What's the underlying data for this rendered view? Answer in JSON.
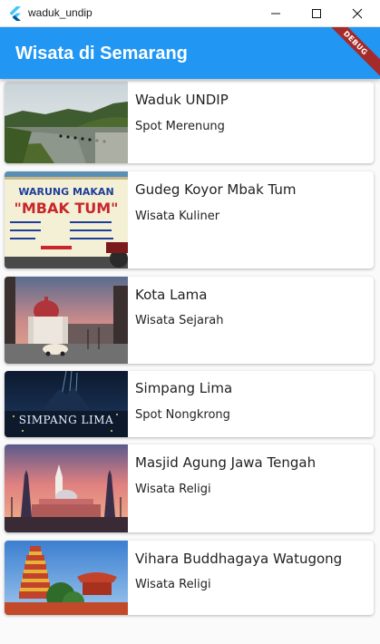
{
  "window": {
    "title": "waduk_undip",
    "controls": [
      "minimize-icon",
      "maximize-icon",
      "close-icon"
    ]
  },
  "appbar": {
    "title": "Wisata di Semarang",
    "debug_banner": "DEBUG",
    "color": "#2196f3"
  },
  "places": [
    {
      "name": "Waduk UNDIP",
      "category": "Spot Merenung",
      "image": "reservoir-photo"
    },
    {
      "name": "Gudeg Koyor Mbak Tum",
      "category": "Wisata Kuliner",
      "image": "warung-makan-sign-photo",
      "image_text": {
        "line1": "WARUNG MAKAN",
        "line2": "\"MBAK TUM\""
      }
    },
    {
      "name": "Kota Lama",
      "category": "Wisata Sejarah",
      "image": "old-town-church-photo"
    },
    {
      "name": "Simpang Lima",
      "category": "Spot Nongkrong",
      "image": "simpang-lima-night-photo",
      "image_text": {
        "line1": "SIMPANG LIMA"
      }
    },
    {
      "name": "Masjid Agung Jawa Tengah",
      "category": "Wisata Religi",
      "image": "grand-mosque-photo"
    },
    {
      "name": "Vihara Buddhagaya Watugong",
      "category": "Wisata Religi",
      "image": "pagoda-photo"
    }
  ]
}
